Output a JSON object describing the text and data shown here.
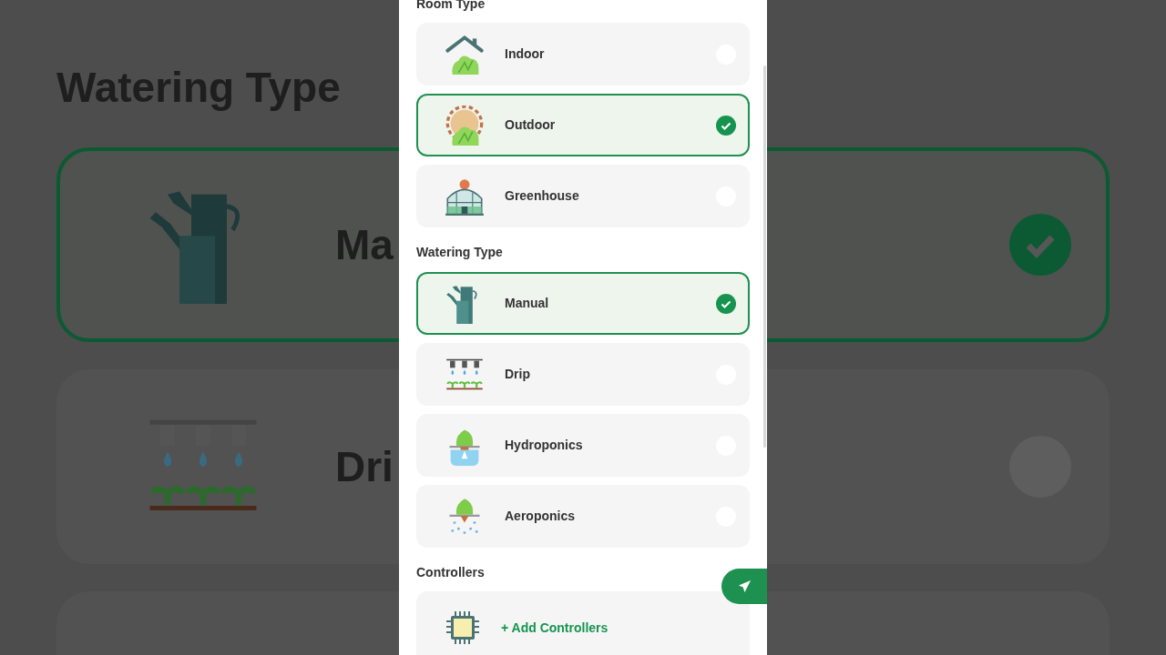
{
  "backdrop": {
    "title": "Watering Type",
    "cards": [
      {
        "label": "Ma",
        "selected": true
      },
      {
        "label": "Dri",
        "selected": false
      }
    ]
  },
  "sections": [
    {
      "title": "Room Type",
      "options": [
        {
          "label": "Indoor",
          "selected": false
        },
        {
          "label": "Outdoor",
          "selected": true
        },
        {
          "label": "Greenhouse",
          "selected": false
        }
      ]
    },
    {
      "title": "Watering Type",
      "options": [
        {
          "label": "Manual",
          "selected": true
        },
        {
          "label": "Drip",
          "selected": false
        },
        {
          "label": "Hydroponics",
          "selected": false
        },
        {
          "label": "Aeroponics",
          "selected": false
        }
      ]
    }
  ],
  "controllers": {
    "title": "Controllers",
    "add_label": "+ Add Controllers"
  }
}
